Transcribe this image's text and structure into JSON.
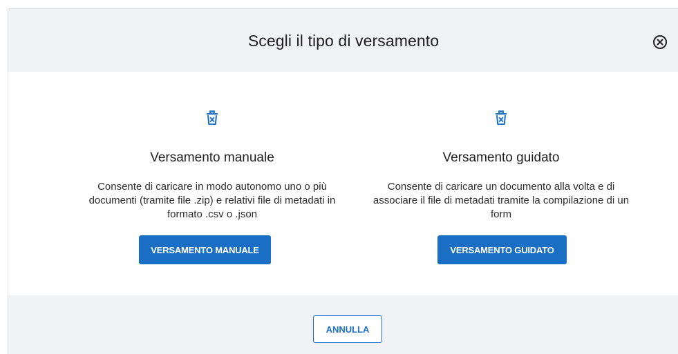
{
  "modal": {
    "title": "Scegli il tipo di versamento",
    "close_icon": "close-circle-icon",
    "accent_color": "#1a6fc4"
  },
  "options": [
    {
      "icon": "trash-icon",
      "title": "Versamento manuale",
      "description": "Consente di caricare in modo autonomo uno o più documenti (tramite file .zip) e relativi file di metadati in formato .csv o .json",
      "button_label": "VERSAMENTO MANUALE"
    },
    {
      "icon": "trash-icon",
      "title": "Versamento guidato",
      "description": "Consente di caricare un documento alla volta e di associare il file di metadati tramite la compilazione di un form",
      "button_label": "VERSAMENTO GUIDATO"
    }
  ],
  "footer": {
    "cancel_label": "ANNULLA"
  }
}
